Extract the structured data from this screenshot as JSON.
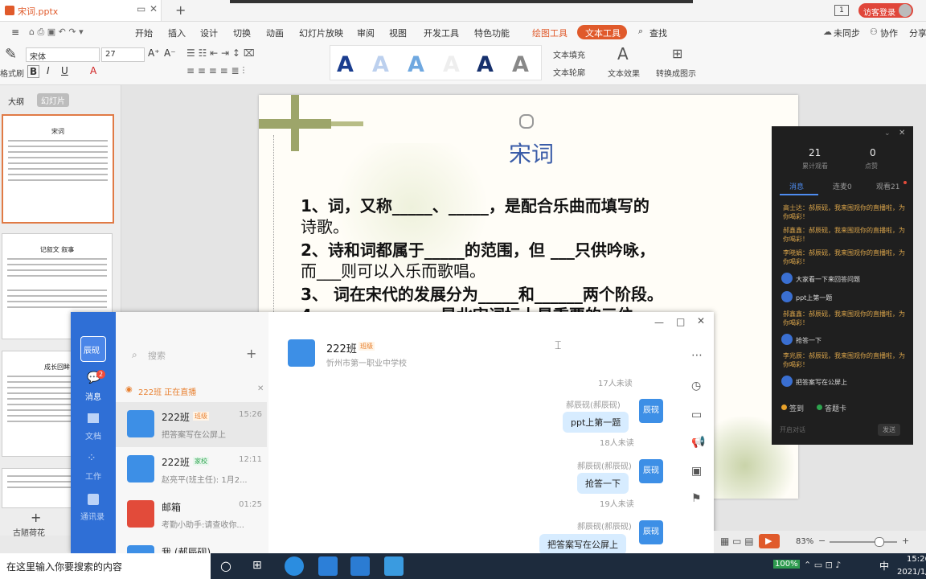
{
  "window": {
    "tab_title": "宋词.pptx",
    "add_tab": "+",
    "page_indicator": "1",
    "login_label": "访客登录"
  },
  "menu": {
    "items": [
      "开始",
      "插入",
      "设计",
      "切换",
      "动画",
      "幻灯片放映",
      "审阅",
      "视图",
      "开发工具",
      "特色功能"
    ],
    "drawing_tools": "绘图工具",
    "text_tools": "文本工具",
    "search": "查找",
    "sync": "未同步",
    "collab": "协作",
    "share": "分享"
  },
  "ribbon": {
    "font_name": "宋体",
    "font_size": "27",
    "format_painter": "格式刷",
    "text_fill": "文本填充",
    "text_outline": "文本轮廓",
    "text_effect": "文本效果",
    "convert": "转换成图示",
    "wordart_letter": "A"
  },
  "leftpane": {
    "tab_outline": "大纲",
    "tab_slides": "幻灯片",
    "thumb1_title": "宋词",
    "thumb2_title": "记叙文 叙事",
    "thumb3_title": "成长回眸",
    "add_slide": "+",
    "bottom_label": "古陋荷花"
  },
  "slide": {
    "title": "宋词",
    "lines": [
      "1、词，又称_____、_____，是配合乐曲而填写的",
      "诗歌。",
      "2、诗和词都属于_____的范围，但 ___只供吟咏，",
      "而___则可以入乐而歌唱。",
      "3、 词在宋代的发展分为_____和______两个阶段。",
      "4、______________是北宋词坛上最重要的三位"
    ]
  },
  "chat": {
    "sidebar": {
      "app_name": "辰砚",
      "badge": "2",
      "nav": [
        "消息",
        "文档",
        "工作",
        "通讯录"
      ]
    },
    "search_placeholder": "搜索",
    "live_banner": "222班 正在直播",
    "conversations": [
      {
        "name": "222班",
        "tag": "班级",
        "time": "15:26",
        "msg": "把答案写在公屏上"
      },
      {
        "name": "222班",
        "tag": "家校",
        "time": "12:11",
        "msg": "赵亮平(班主任): 1月2..."
      },
      {
        "name": "邮箱",
        "tag": "",
        "time": "01:25",
        "msg": "考勤小助手:请查收你..."
      },
      {
        "name": "我 (郝辰砚)",
        "tag": "",
        "time": "",
        "msg": ""
      }
    ],
    "header": {
      "name": "222班",
      "tag": "班级",
      "sub": "忻州市第一职业中学校"
    },
    "messages": [
      {
        "sender": "郝辰砚(郝辰砚)",
        "text": "ppt上第一题",
        "read": "18人未读"
      },
      {
        "sender": "郝辰砚(郝辰砚)",
        "text": "抢答一下",
        "read": "19人未读"
      },
      {
        "sender": "郝辰砚(郝辰砚)",
        "text": "把答案写在公屏上",
        "read": ""
      }
    ],
    "top_read": "17人未读",
    "self_avatar": "辰砚"
  },
  "live_panel": {
    "count1": "21",
    "count1_label": "累计观看",
    "count2": "0",
    "count2_label": "点赞",
    "tabs": [
      "消息",
      "连麦0",
      "观看21"
    ],
    "messages": [
      {
        "type": "sys",
        "text": "高士达：郝辰砚，我来围观你的直播啦，为你喝彩！"
      },
      {
        "type": "sys",
        "text": "郝鑫鑫：郝辰砚，我来围观你的直播啦，为你喝彩！"
      },
      {
        "type": "sys",
        "text": "李晓娟：郝辰砚，我来围观你的直播啦，为你喝彩！"
      },
      {
        "type": "user",
        "text": "大家看一下来回答问题"
      },
      {
        "type": "user",
        "text": "ppt上第一题"
      },
      {
        "type": "sys",
        "text": "郝鑫鑫：郝辰砚，我来围观你的直播啦，为你喝彩！"
      },
      {
        "type": "user",
        "text": "抢答一下"
      },
      {
        "type": "sys",
        "text": "李兆辰：郝辰砚，我来围观你的直播啦，为你喝彩！"
      },
      {
        "type": "user",
        "text": "把答案写在公屏上"
      }
    ],
    "sign_in": "签到",
    "answer_card": "答题卡",
    "input_placeholder": "开启对话",
    "send": "发送"
  },
  "statusbar": {
    "zoom": "83%"
  },
  "taskbar": {
    "search_placeholder": "在这里输入你要搜索的内容",
    "battery": "100%",
    "ime": "中",
    "time": "15:26",
    "date": "2021/1/"
  },
  "colors": {
    "accent": "#e05a2b",
    "chat_blue": "#2f6fd6",
    "title_blue": "#3a5ca8"
  }
}
